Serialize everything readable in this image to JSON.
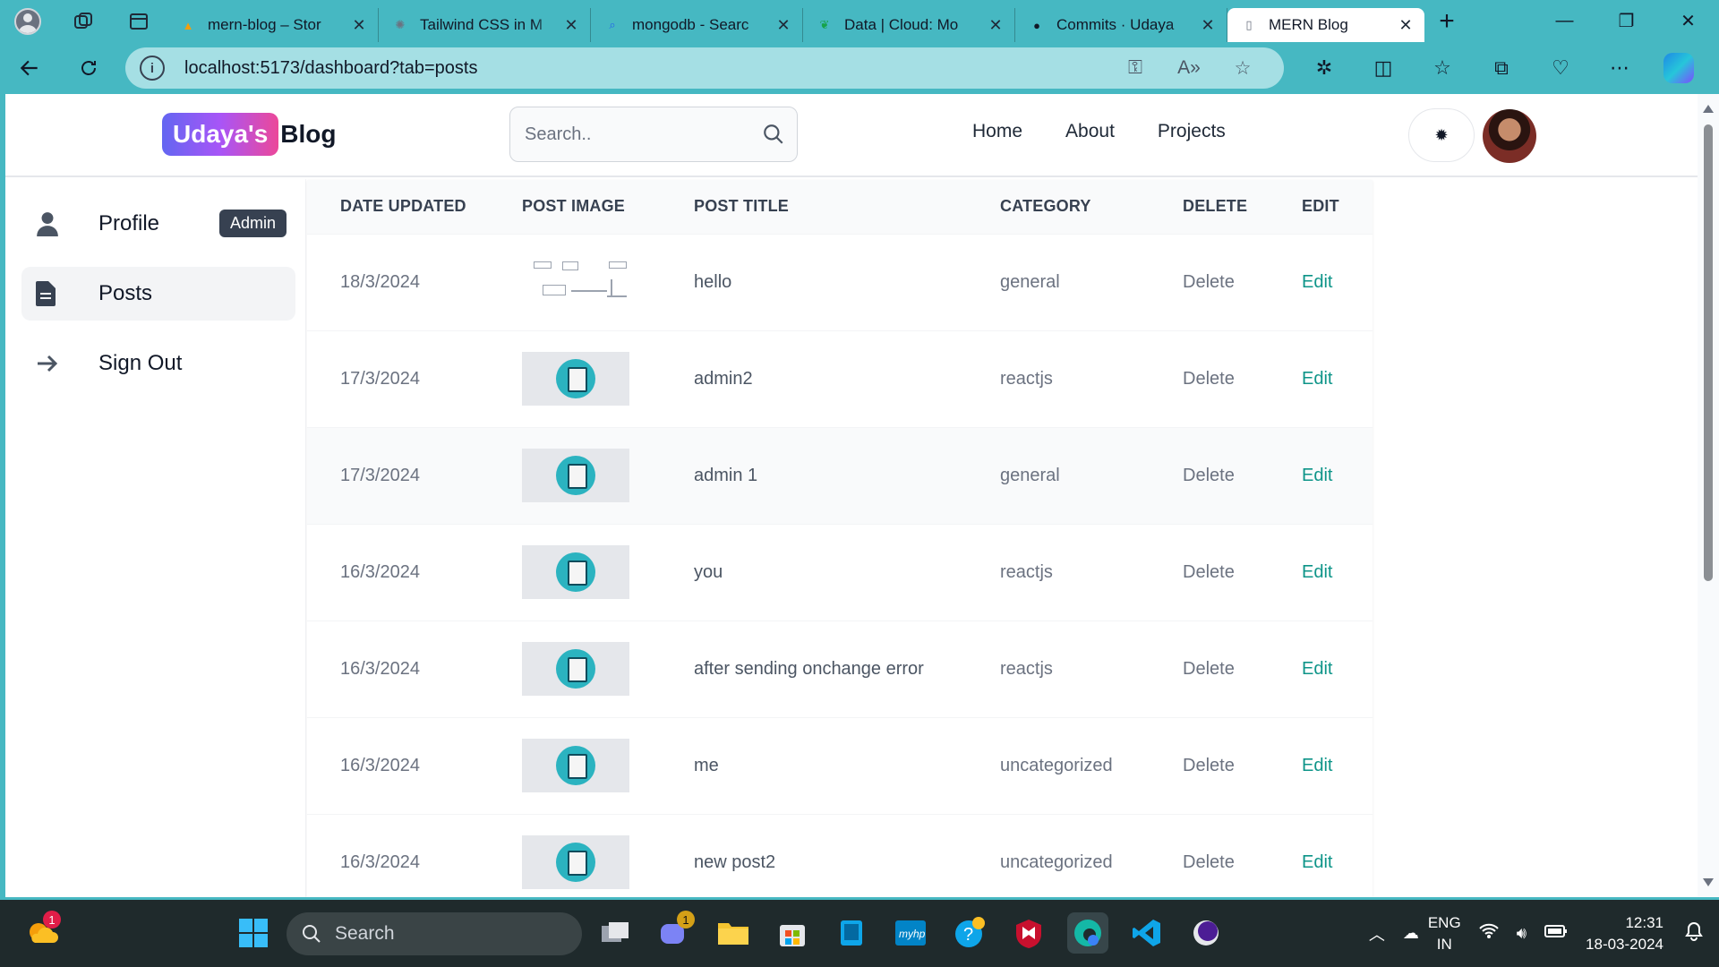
{
  "browser": {
    "tabs": [
      {
        "title": "mern-blog – Stor",
        "favicon": "firebase-icon"
      },
      {
        "title": "Tailwind CSS in M",
        "favicon": "openai-icon"
      },
      {
        "title": "mongodb - Searc",
        "favicon": "search-icon"
      },
      {
        "title": "Data | Cloud: Mo",
        "favicon": "mongodb-icon"
      },
      {
        "title": "Commits · Udaya",
        "favicon": "github-icon"
      },
      {
        "title": "MERN Blog",
        "favicon": "page-icon",
        "active": true
      }
    ],
    "url": "localhost:5173/dashboard?tab=posts"
  },
  "header": {
    "logo_highlight": "Udaya's",
    "logo_text": "Blog",
    "search_placeholder": "Search..",
    "nav": [
      "Home",
      "About",
      "Projects"
    ]
  },
  "sidebar": {
    "items": [
      {
        "label": "Profile",
        "icon": "user-icon",
        "badge": "Admin"
      },
      {
        "label": "Posts",
        "icon": "document-icon",
        "active": true
      },
      {
        "label": "Sign Out",
        "icon": "arrow-right-icon"
      }
    ]
  },
  "posts_table": {
    "columns": [
      "DATE UPDATED",
      "POST IMAGE",
      "POST TITLE",
      "CATEGORY",
      "DELETE",
      "EDIT"
    ],
    "rows": [
      {
        "date": "18/3/2024",
        "title": "hello",
        "category": "general",
        "delete": "Delete",
        "edit": "Edit",
        "image": "sketch"
      },
      {
        "date": "17/3/2024",
        "title": "admin2",
        "category": "reactjs",
        "delete": "Delete",
        "edit": "Edit",
        "image": "default"
      },
      {
        "date": "17/3/2024",
        "title": "admin 1",
        "category": "general",
        "delete": "Delete",
        "edit": "Edit",
        "image": "default"
      },
      {
        "date": "16/3/2024",
        "title": "you",
        "category": "reactjs",
        "delete": "Delete",
        "edit": "Edit",
        "image": "default"
      },
      {
        "date": "16/3/2024",
        "title": "after sending onchange error",
        "category": "reactjs",
        "delete": "Delete",
        "edit": "Edit",
        "image": "default"
      },
      {
        "date": "16/3/2024",
        "title": "me",
        "category": "uncategorized",
        "delete": "Delete",
        "edit": "Edit",
        "image": "default"
      },
      {
        "date": "16/3/2024",
        "title": "new post2",
        "category": "uncategorized",
        "delete": "Delete",
        "edit": "Edit",
        "image": "default"
      }
    ]
  },
  "taskbar": {
    "search_label": "Search",
    "weather_badge": "1",
    "teams_badge": "1",
    "language": "ENG",
    "region": "IN",
    "time": "12:31",
    "date": "18-03-2024"
  },
  "colors": {
    "accent_teal": "#46b8c2",
    "edit_link": "#0d9488",
    "logo_gradient": [
      "#6366f1",
      "#a855f7",
      "#ec4899"
    ]
  }
}
